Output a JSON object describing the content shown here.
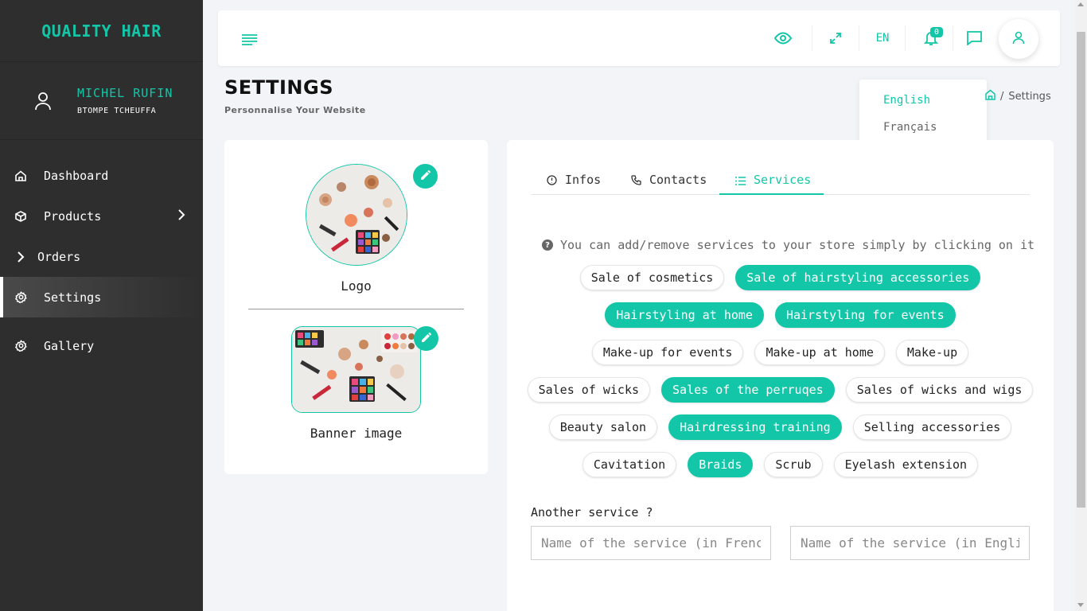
{
  "sidebar": {
    "brand": "QUALITY HAIR",
    "user": {
      "name": "MICHEL RUFIN",
      "subtitle": "BTOMPE TCHEUFFA"
    },
    "items": [
      {
        "label": "Dashboard",
        "icon": "home-icon"
      },
      {
        "label": "Products",
        "icon": "box-icon"
      },
      {
        "label": "Orders",
        "icon": "chevron-right-icon"
      },
      {
        "label": "Settings",
        "icon": "gear-icon",
        "active": true
      },
      {
        "label": "Gallery",
        "icon": "gear-icon"
      }
    ]
  },
  "header": {
    "language": "EN",
    "notifications_count": "0",
    "icons": [
      "menu-icon",
      "eye-icon",
      "fullscreen-icon",
      "bell-icon",
      "chat-icon",
      "user-icon"
    ]
  },
  "lang_menu": {
    "options": [
      "English",
      "Français"
    ],
    "selected": "English"
  },
  "page": {
    "title": "SETTINGS",
    "subtitle": "Personnalise Your Website",
    "breadcrumb_current": "Settings"
  },
  "images": {
    "logo_label": "Logo",
    "banner_label": "Banner image"
  },
  "tabs": [
    "Infos",
    "Contacts",
    "Services"
  ],
  "active_tab": "Services",
  "services": {
    "hint": "You can add/remove services to your store simply by clicking on it",
    "rows": [
      [
        {
          "label": "Sale of cosmetics",
          "selected": false
        },
        {
          "label": "Sale of hairstyling accessories",
          "selected": true
        }
      ],
      [
        {
          "label": "Hairstyling at home",
          "selected": true
        },
        {
          "label": "Hairstyling for events",
          "selected": true
        }
      ],
      [
        {
          "label": "Make-up for events",
          "selected": false
        },
        {
          "label": "Make-up at home",
          "selected": false
        },
        {
          "label": "Make-up",
          "selected": false
        }
      ],
      [
        {
          "label": "Sales of wicks",
          "selected": false
        },
        {
          "label": "Sales of the perruqes",
          "selected": true
        },
        {
          "label": "Sales of wicks and wigs",
          "selected": false
        }
      ],
      [
        {
          "label": "Beauty salon",
          "selected": false
        },
        {
          "label": "Hairdressing training",
          "selected": true
        },
        {
          "label": "Selling accessories",
          "selected": false
        }
      ],
      [
        {
          "label": "Cavitation",
          "selected": false
        },
        {
          "label": "Braids",
          "selected": true
        },
        {
          "label": "Scrub",
          "selected": false
        },
        {
          "label": "Eyelash extension",
          "selected": false
        }
      ]
    ],
    "another_label": "Another service ?",
    "placeholder_fr": "Name of the service (in French)",
    "placeholder_en": "Name of the service (in English)"
  },
  "colors": {
    "accent": "#14c6a8",
    "sidebar_bg": "#2e2e2e",
    "page_bg": "#f2f4f7"
  }
}
